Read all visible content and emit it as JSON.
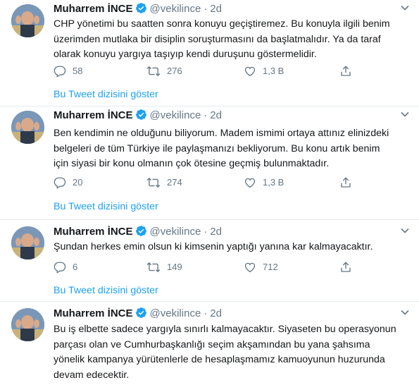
{
  "tweets": [
    {
      "name": "Muharrem İNCE",
      "handle": "@vekilince",
      "dot": "·",
      "time": "2d",
      "lines": [
        "CHP yönetimi bu saatten sonra konuyu geçiştiremez. Bu konuyla ilgili benim",
        "üzerimden mutlaka bir disiplin soruşturmasını da başlatmalıdır. Ya da  taraf",
        "olarak konuyu yargıya taşıyıp kendi duruşunu göstermelidir."
      ],
      "replies": "58",
      "retweets": "276",
      "likes": "1,3 B",
      "thread_link": "Bu Tweet dizisini göster"
    },
    {
      "name": "Muharrem İNCE",
      "handle": "@vekilince",
      "dot": "·",
      "time": "2d",
      "lines": [
        "Ben kendimin ne olduğunu biliyorum. Madem ismimi ortaya attınız elinizdeki",
        "belgeleri de tüm Türkiye ile paylaşmanızı bekliyorum.  Bu konu artık benim",
        "için siyasi bir konu olmanın çok ötesine geçmiş bulunmaktadır."
      ],
      "replies": "20",
      "retweets": "274",
      "likes": "1,3 B",
      "thread_link": "Bu Tweet dizisini göster"
    },
    {
      "name": "Muharrem İNCE",
      "handle": "@vekilince",
      "dot": "·",
      "time": "2d",
      "lines": [
        "Şundan herkes emin olsun ki kimsenin yaptığı yanına kar kalmayacaktır."
      ],
      "replies": "6",
      "retweets": "149",
      "likes": "712",
      "thread_link": "Bu Tweet dizisini göster"
    },
    {
      "name": "Muharrem İNCE",
      "handle": "@vekilince",
      "dot": "·",
      "time": "2d",
      "lines": [
        "Bu iş elbette sadece yargıyla sınırlı kalmayacaktır. Siyaseten bu operasyonun",
        "parçası olan ve Cumhurbaşkanlığı seçim akşamından bu yana şahsıma",
        "yönelik kampanya yürütenlerle de hesaplaşmamız kamuoyunun huzurunda",
        "devam edecektir."
      ]
    }
  ],
  "icons": {
    "reply": "reply-icon",
    "retweet": "retweet-icon",
    "like": "heart-icon",
    "share": "share-icon",
    "verified": "verified-badge-icon",
    "more": "chevron-down-icon"
  },
  "colors": {
    "link": "#1da1f2",
    "secondary": "#657786",
    "divider": "#e6ecf0",
    "text": "#14171a"
  }
}
